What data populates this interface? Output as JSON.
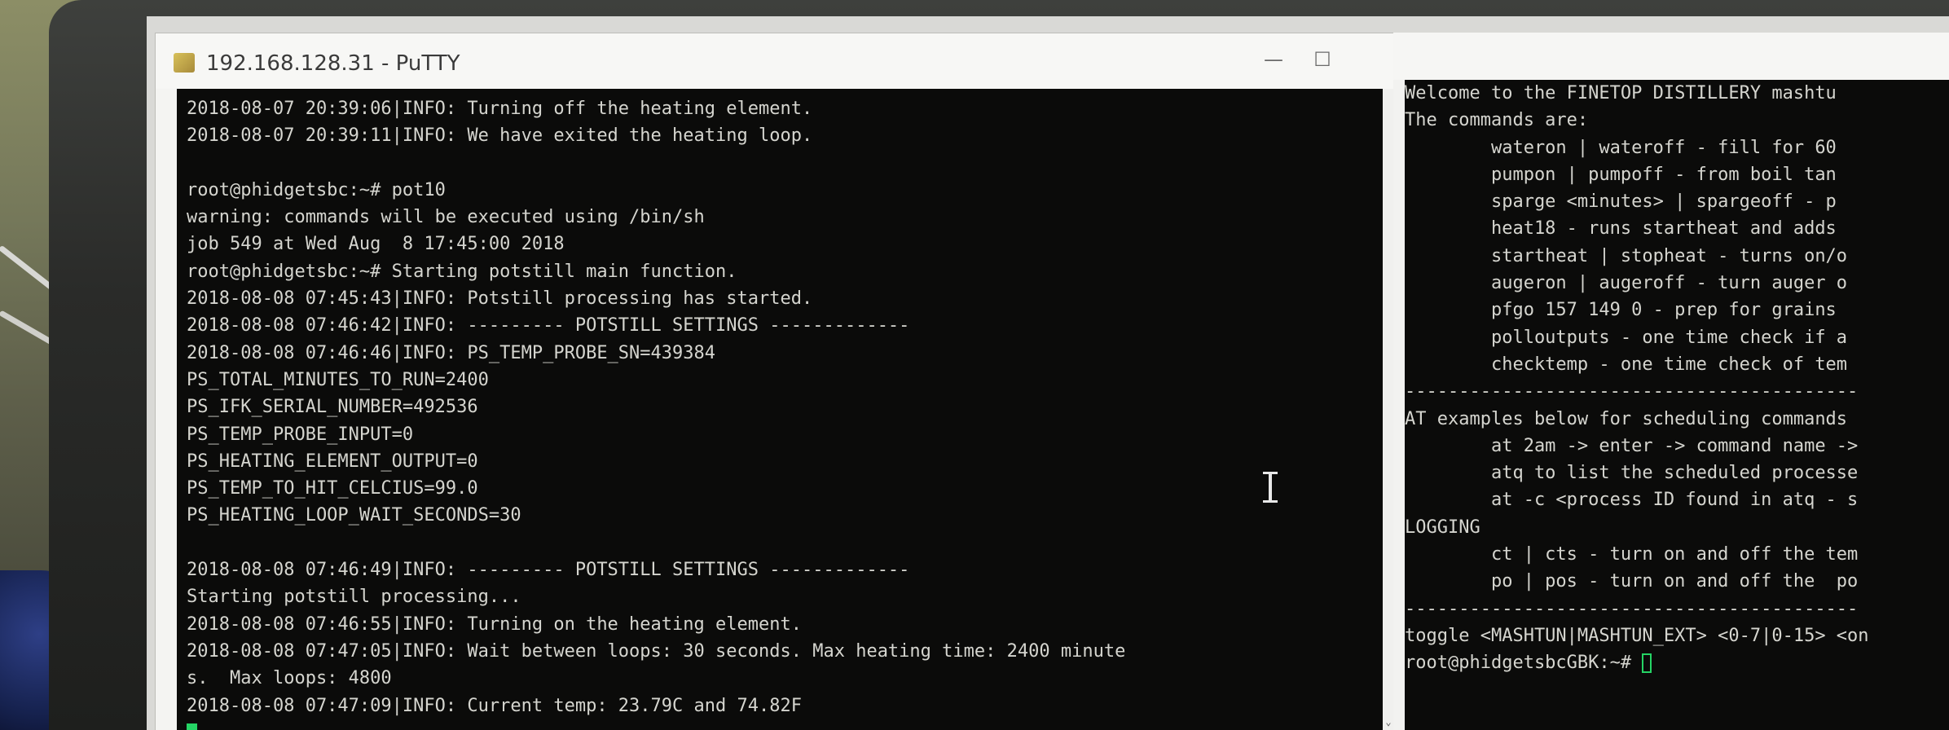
{
  "window1": {
    "title": "192.168.128.31 - PuTTY",
    "minimize_glyph": "—",
    "maximize_glyph": "☐",
    "scroll_down_glyph": "⌄",
    "lines": [
      "2018-08-07 20:39:06|INFO: Turning off the heating element.",
      "2018-08-07 20:39:11|INFO: We have exited the heating loop.",
      "",
      "root@phidgetsbc:~# pot10",
      "warning: commands will be executed using /bin/sh",
      "job 549 at Wed Aug  8 17:45:00 2018",
      "root@phidgetsbc:~# Starting potstill main function.",
      "2018-08-08 07:45:43|INFO: Potstill processing has started.",
      "2018-08-08 07:46:42|INFO: --------- POTSTILL SETTINGS -------------",
      "2018-08-08 07:46:46|INFO: PS_TEMP_PROBE_SN=439384",
      "PS_TOTAL_MINUTES_TO_RUN=2400",
      "PS_IFK_SERIAL_NUMBER=492536",
      "PS_TEMP_PROBE_INPUT=0",
      "PS_HEATING_ELEMENT_OUTPUT=0",
      "PS_TEMP_TO_HIT_CELCIUS=99.0",
      "PS_HEATING_LOOP_WAIT_SECONDS=30",
      "",
      "2018-08-08 07:46:49|INFO: --------- POTSTILL SETTINGS -------------",
      "Starting potstill processing...",
      "2018-08-08 07:46:55|INFO: Turning on the heating element.",
      "2018-08-08 07:47:05|INFO: Wait between loops: 30 seconds. Max heating time: 2400 minute",
      "s.  Max loops: 4800",
      "2018-08-08 07:47:09|INFO: Current temp: 23.79C and 74.82F"
    ]
  },
  "window2": {
    "lines": [
      "Welcome to the FINETOP DISTILLERY mashtu",
      "The commands are:",
      "        wateron | wateroff - fill for 60",
      "        pumpon | pumpoff - from boil tan",
      "        sparge <minutes> | spargeoff - p",
      "        heat18 - runs startheat and adds",
      "        startheat | stopheat - turns on/o",
      "        augeron | augeroff - turn auger o",
      "        pfgo 157 149 0 - prep for grains",
      "        polloutputs - one time check if a",
      "        checktemp - one time check of tem",
      "------------------------------------------",
      "AT examples below for scheduling commands",
      "        at 2am -> enter -> command name ->",
      "        atq to list the scheduled processe",
      "        at -c <process ID found in atq - s",
      "LOGGING",
      "        ct | cts - turn on and off the tem",
      "        po | pos - turn on and off the  po",
      "------------------------------------------",
      "toggle <MASHTUN|MASHTUN_EXT> <0-7|0-15> <on",
      "root@phidgetsbcGBK:~# "
    ]
  }
}
